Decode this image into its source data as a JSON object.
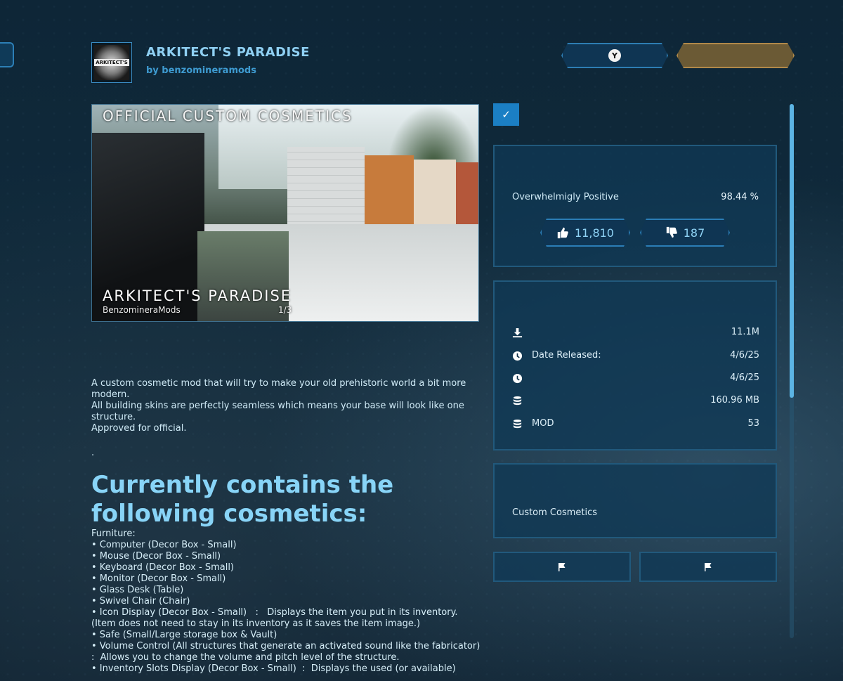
{
  "header": {
    "mod_title": "ARKITECT'S PARADISE",
    "author": "by benzomineramods",
    "logo_text": "ARKITECT'S",
    "y_button_badge": "Y"
  },
  "preview": {
    "overlay_top": "OFFICIAL CUSTOM COSMETICS",
    "overlay_title": "ARKITECT'S PARADISE",
    "overlay_author": "BenzomineraMods",
    "counter": "1/3"
  },
  "description": {
    "lines": [
      "A custom cosmetic mod that will try to make your old prehistoric world a bit more modern.",
      "All building skins are perfectly seamless which means your base will look like one structure.",
      "Approved for official."
    ],
    "separator": ".",
    "heading": "Currently contains the following cosmetics:",
    "list": [
      "Furniture:",
      "• Computer (Decor Box - Small)",
      "• Mouse (Decor Box - Small)",
      "• Keyboard (Decor Box - Small)",
      "• Monitor (Decor Box - Small)",
      "• Glass Desk (Table)",
      "• Swivel Chair (Chair)",
      "• Icon Display (Decor Box - Small)   :   Displays the item you put in its inventory. (Item does not need to stay in its inventory as it saves the item image.)",
      "• Safe (Small/Large storage box & Vault)",
      "• Volume Control (All structures that generate an activated sound like the fabricator)  :  Allows you to change the volume and pitch level of the structure.",
      "• Inventory Slots Display (Decor Box - Small)  :  Displays the used (or available)"
    ]
  },
  "rating": {
    "label": "Overwhelmigly Positive",
    "percent": "98.44 %",
    "upvotes": "11,810",
    "downvotes": "187"
  },
  "info": {
    "rows": [
      {
        "icon": "download-icon",
        "label": "",
        "value": "11.1M"
      },
      {
        "icon": "clock-icon",
        "label": "Date Released:",
        "value": "4/6/25"
      },
      {
        "icon": "clock-icon",
        "label": "",
        "value": "4/6/25"
      },
      {
        "icon": "database-icon",
        "label": "",
        "value": "160.96 MB"
      },
      {
        "icon": "database-icon",
        "label": "MOD",
        "value": "53"
      }
    ]
  },
  "tags": {
    "category": "Custom Cosmetics"
  },
  "colors": {
    "accent": "#1b7fc4",
    "title": "#8fd0f3",
    "subscribe_gold": "#b0894a"
  }
}
